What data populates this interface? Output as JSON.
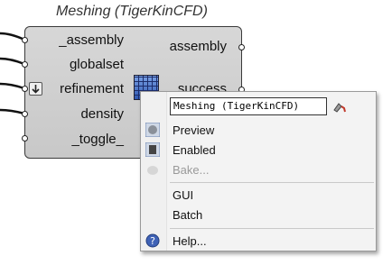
{
  "component": {
    "title": "Meshing (TigerKinCFD)",
    "inputs": [
      "_assembly",
      "globalset",
      "refinement",
      "density",
      "_toggle_"
    ],
    "outputs": [
      "assembly",
      "success"
    ]
  },
  "context_menu": {
    "name_value": "Meshing (TigerKinCFD)",
    "items": {
      "preview": "Preview",
      "enabled": "Enabled",
      "bake": "Bake...",
      "gui": "GUI",
      "batch": "Batch",
      "help": "Help..."
    },
    "icons": {
      "preview": "preview-sphere-icon",
      "enabled": "enabled-switch-icon",
      "bake": "bake-icon",
      "help": "help-icon",
      "name": "brush-icon"
    }
  }
}
